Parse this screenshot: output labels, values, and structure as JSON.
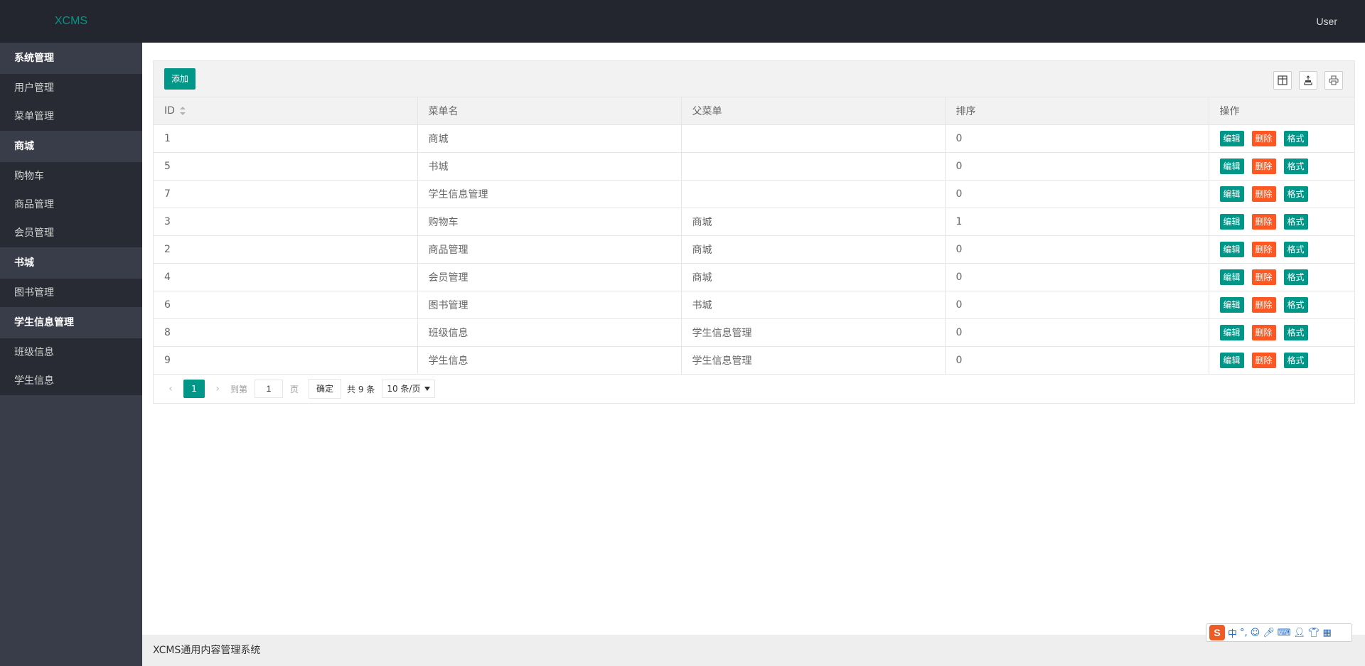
{
  "header": {
    "logo": "XCMS",
    "user": "User"
  },
  "sidebar": {
    "groups": [
      {
        "title": "系统管理",
        "items": [
          "用户管理",
          "菜单管理"
        ]
      },
      {
        "title": "商城",
        "items": [
          "购物车",
          "商品管理",
          "会员管理"
        ]
      },
      {
        "title": "书城",
        "items": [
          "图书管理"
        ]
      },
      {
        "title": "学生信息管理",
        "items": [
          "班级信息",
          "学生信息"
        ]
      }
    ]
  },
  "toolbar": {
    "add_label": "添加",
    "icons": [
      "columns-icon",
      "export-icon",
      "print-icon"
    ]
  },
  "table": {
    "columns": [
      "ID",
      "菜单名",
      "父菜单",
      "排序",
      "操作"
    ],
    "rows": [
      {
        "id": "1",
        "name": "商城",
        "parent": "",
        "order": "0"
      },
      {
        "id": "5",
        "name": "书城",
        "parent": "",
        "order": "0"
      },
      {
        "id": "7",
        "name": "学生信息管理",
        "parent": "",
        "order": "0"
      },
      {
        "id": "3",
        "name": "购物车",
        "parent": "商城",
        "order": "1"
      },
      {
        "id": "2",
        "name": "商品管理",
        "parent": "商城",
        "order": "0"
      },
      {
        "id": "4",
        "name": "会员管理",
        "parent": "商城",
        "order": "0"
      },
      {
        "id": "6",
        "name": "图书管理",
        "parent": "书城",
        "order": "0"
      },
      {
        "id": "8",
        "name": "班级信息",
        "parent": "学生信息管理",
        "order": "0"
      },
      {
        "id": "9",
        "name": "学生信息",
        "parent": "学生信息管理",
        "order": "0"
      }
    ],
    "actions": {
      "edit": "编辑",
      "delete": "删除",
      "format": "格式"
    }
  },
  "pager": {
    "current": "1",
    "goto_label": "到第",
    "page_value": "1",
    "page_unit": "页",
    "confirm": "确定",
    "total": "共 9 条",
    "page_size": "10 条/页"
  },
  "footer": {
    "text": "XCMS通用内容管理系统"
  },
  "colors": {
    "accent": "#009688",
    "danger": "#ff5722",
    "header_bg": "#23262e",
    "sidebar_bg": "#393d49"
  }
}
